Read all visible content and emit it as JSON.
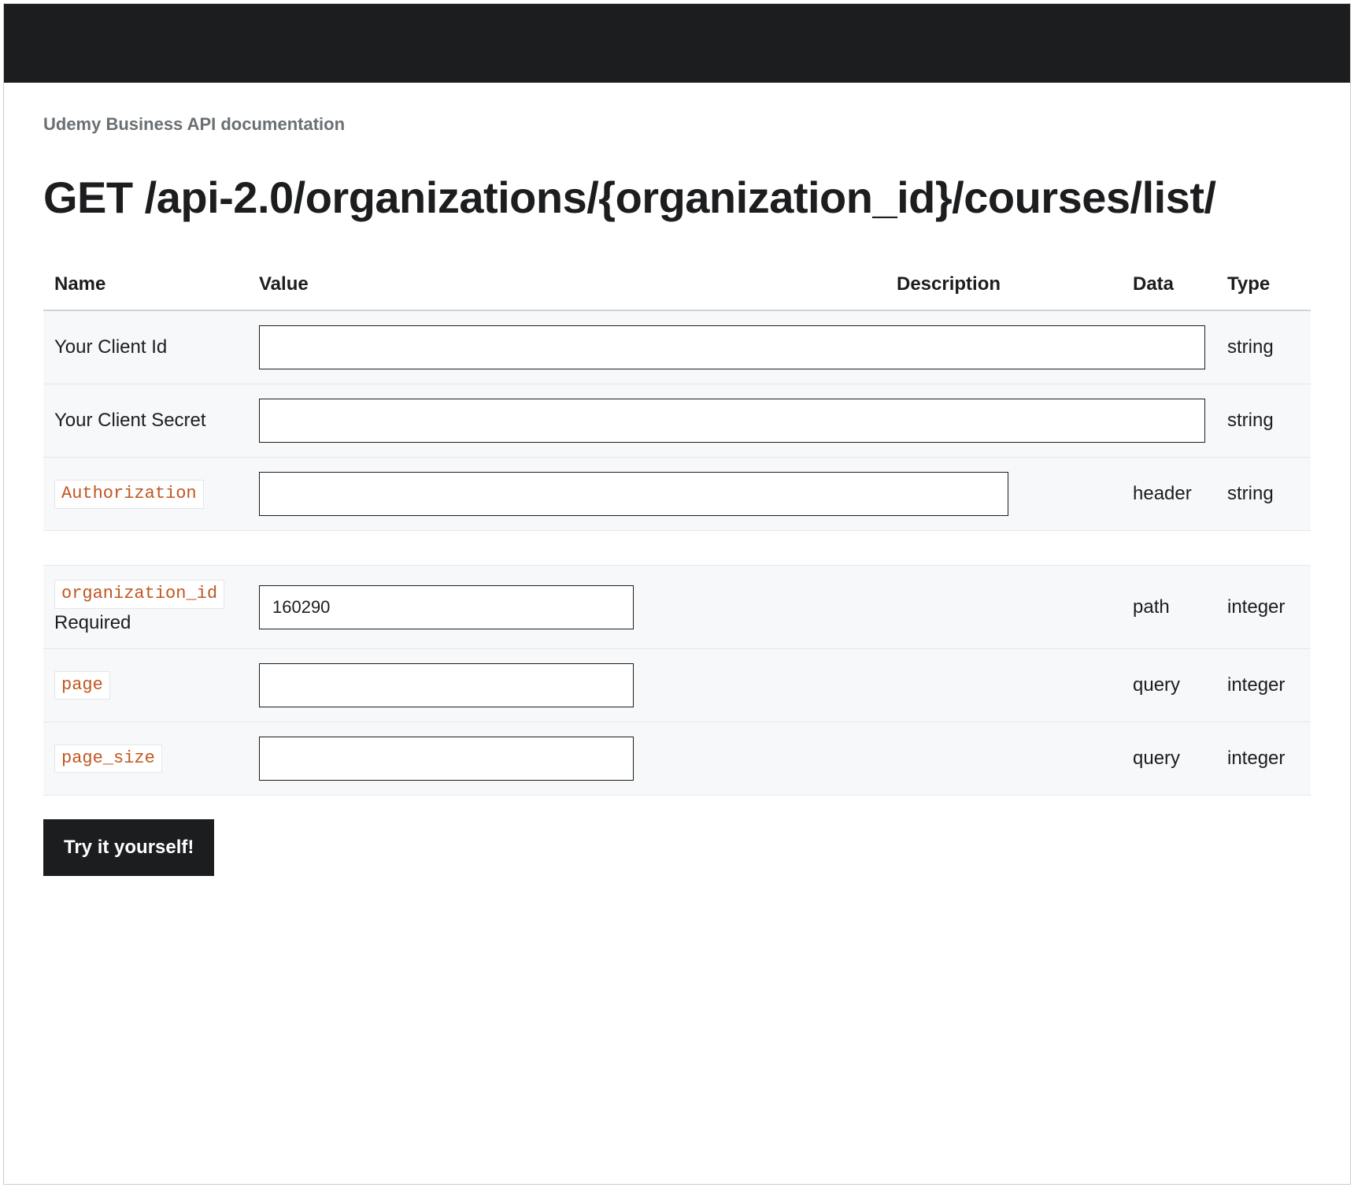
{
  "breadcrumb": "Udemy Business API documentation",
  "heading": "GET /api-2.0/organizations/{organization_id}/courses/list/",
  "columns": {
    "name": "Name",
    "value": "Value",
    "description": "Description",
    "data": "Data",
    "type": "Type"
  },
  "rows": {
    "client_id": {
      "name": "Your Client Id",
      "value": "",
      "data": "",
      "type": "string"
    },
    "client_secret": {
      "name": "Your Client Secret",
      "value": "",
      "data": "",
      "type": "string"
    },
    "authorization": {
      "name": "Authorization",
      "value": "",
      "data": "header",
      "type": "string"
    },
    "organization_id": {
      "name": "organization_id",
      "required": "Required",
      "value": "160290",
      "data": "path",
      "type": "integer"
    },
    "page": {
      "name": "page",
      "value": "",
      "data": "query",
      "type": "integer"
    },
    "page_size": {
      "name": "page_size",
      "value": "",
      "data": "query",
      "type": "integer"
    }
  },
  "submit_label": "Try it yourself!"
}
